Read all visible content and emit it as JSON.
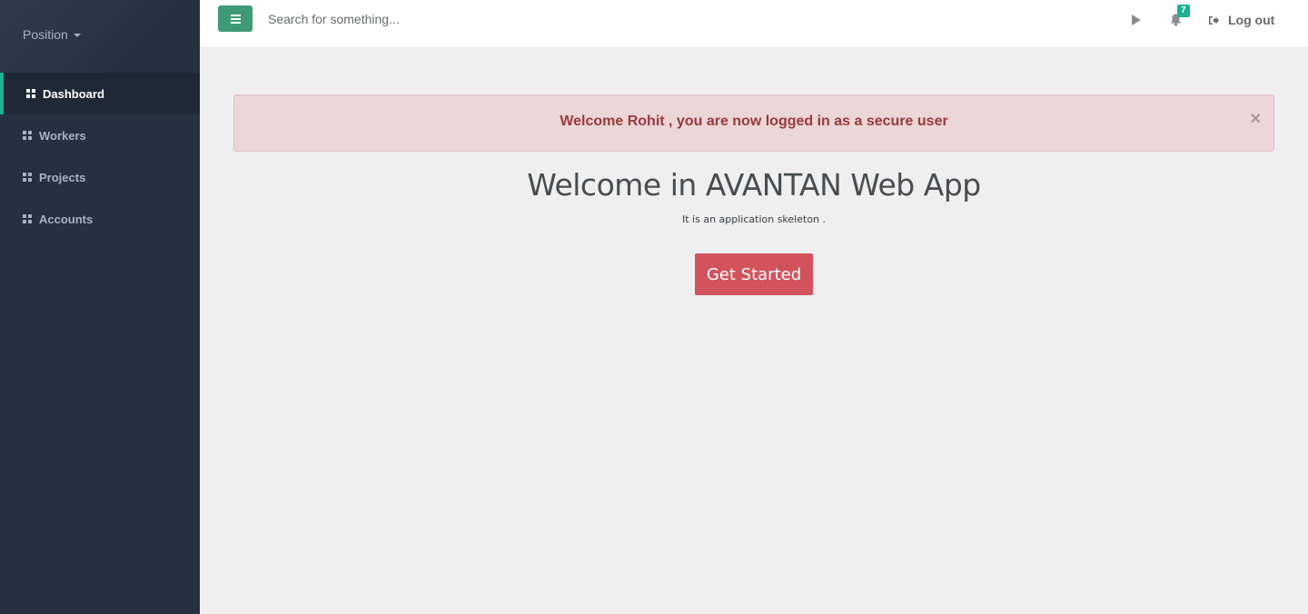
{
  "sidebar": {
    "position_label": "Position",
    "items": [
      {
        "label": "Dashboard",
        "icon": "grid-icon",
        "active": true
      },
      {
        "label": "Workers",
        "icon": "grid-icon",
        "active": false
      },
      {
        "label": "Projects",
        "icon": "grid-icon",
        "active": false
      },
      {
        "label": "Accounts",
        "icon": "grid-icon",
        "active": false
      }
    ]
  },
  "topbar": {
    "search_placeholder": "Search for something...",
    "notification_count": "7",
    "logout_label": "Log out",
    "icons": [
      "hamburger-icon",
      "play-icon",
      "bell-icon",
      "sign-out-icon"
    ]
  },
  "alert": {
    "message": "Welcome Rohit , you are now logged in as a secure user",
    "close": "×"
  },
  "main": {
    "title": "Welcome in AVANTAN Web App",
    "subtitle": "It is an application skeleton .",
    "cta_label": "Get Started"
  },
  "colors": {
    "sidebar_bg": "#263140",
    "accent_green": "#1ab394",
    "toggle_green": "#3f9a78",
    "cta_red": "#d2535c",
    "alert_bg": "#ebd6d8",
    "alert_text": "#9a3a3a"
  }
}
